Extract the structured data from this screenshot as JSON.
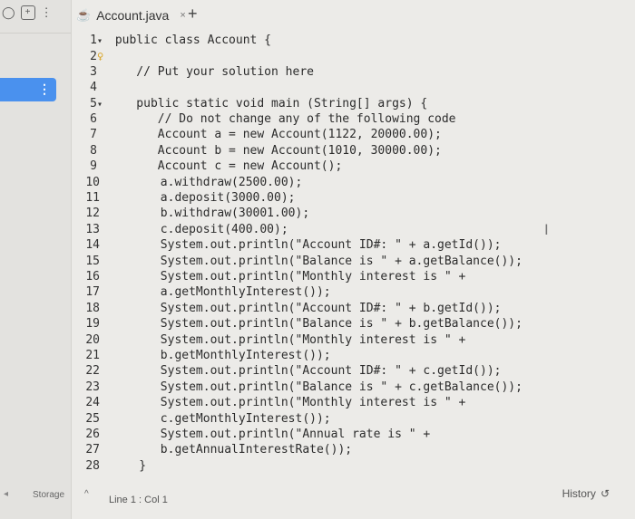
{
  "tab": {
    "filename": "Account.java",
    "close": "×",
    "add": "+"
  },
  "sidebar": {
    "storage": "Storage",
    "more": "⋮"
  },
  "status": {
    "position": "Line 1 : Col 1",
    "history": "History"
  },
  "code_lines": [
    {
      "n": "1",
      "text": "public class Account {",
      "fold": true
    },
    {
      "n": "2",
      "text": "",
      "bulb": true
    },
    {
      "n": "3",
      "text": "   // Put your solution here"
    },
    {
      "n": "4",
      "text": ""
    },
    {
      "n": "5",
      "text": "   public static void main (String[] args) {",
      "fold": true
    },
    {
      "n": "6",
      "text": "      // Do not change any of the following code"
    },
    {
      "n": "7",
      "text": "      Account a = new Account(1122, 20000.00);"
    },
    {
      "n": "8",
      "text": "      Account b = new Account(1010, 30000.00);"
    },
    {
      "n": "9",
      "text": "      Account c = new Account();"
    },
    {
      "n": "10",
      "text": "      a.withdraw(2500.00);"
    },
    {
      "n": "11",
      "text": "      a.deposit(3000.00);"
    },
    {
      "n": "12",
      "text": "      b.withdraw(30001.00);"
    },
    {
      "n": "13",
      "text": "      c.deposit(400.00);"
    },
    {
      "n": "14",
      "text": "      System.out.println(\"Account ID#: \" + a.getId());"
    },
    {
      "n": "15",
      "text": "      System.out.println(\"Balance is \" + a.getBalance());"
    },
    {
      "n": "16",
      "text": "      System.out.println(\"Monthly interest is \" +"
    },
    {
      "n": "17",
      "text": "      a.getMonthlyInterest());"
    },
    {
      "n": "18",
      "text": "      System.out.println(\"Account ID#: \" + b.getId());"
    },
    {
      "n": "19",
      "text": "      System.out.println(\"Balance is \" + b.getBalance());"
    },
    {
      "n": "20",
      "text": "      System.out.println(\"Monthly interest is \" +"
    },
    {
      "n": "21",
      "text": "      b.getMonthlyInterest());"
    },
    {
      "n": "22",
      "text": "      System.out.println(\"Account ID#: \" + c.getId());"
    },
    {
      "n": "23",
      "text": "      System.out.println(\"Balance is \" + c.getBalance());"
    },
    {
      "n": "24",
      "text": "      System.out.println(\"Monthly interest is \" +"
    },
    {
      "n": "25",
      "text": "      c.getMonthlyInterest());"
    },
    {
      "n": "26",
      "text": "      System.out.println(\"Annual rate is \" +"
    },
    {
      "n": "27",
      "text": "      b.getAnnualInterestRate());"
    },
    {
      "n": "28",
      "text": "   }"
    }
  ]
}
